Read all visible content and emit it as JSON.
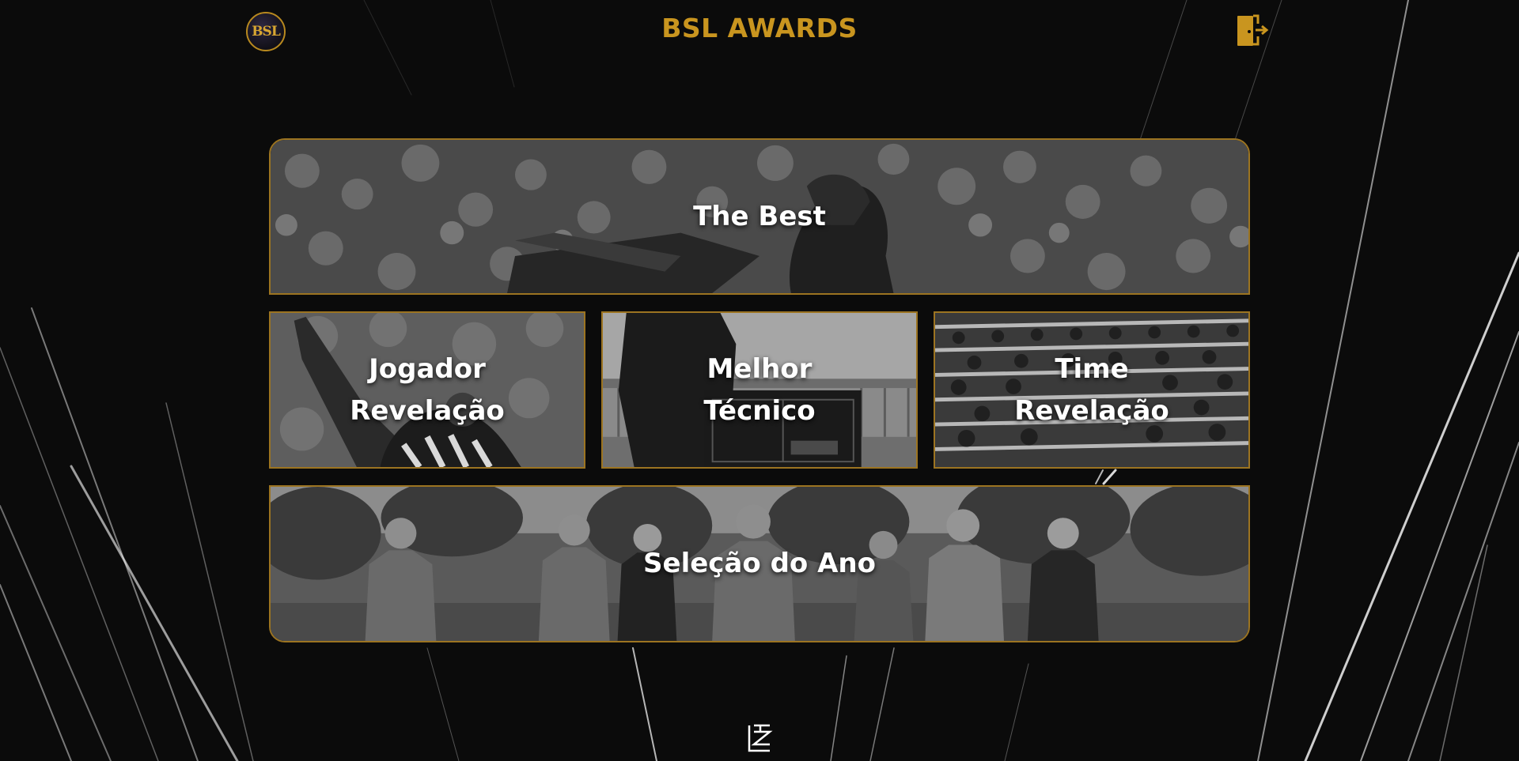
{
  "header": {
    "logo_text": "BSL",
    "title": "BSL AWARDS",
    "logout_icon": "door-exit-icon"
  },
  "categories": [
    {
      "label": "The Best"
    },
    {
      "label": "Jogador\nRevelação"
    },
    {
      "label": "Melhor\nTécnico"
    },
    {
      "label": "Time\nRevelação"
    },
    {
      "label": "Seleção do Ano"
    }
  ],
  "footer": {
    "mark_icon": "signature-logo-icon"
  },
  "colors": {
    "accent": "#c9951f",
    "border": "#9c7421",
    "background": "#0b0b0b"
  }
}
